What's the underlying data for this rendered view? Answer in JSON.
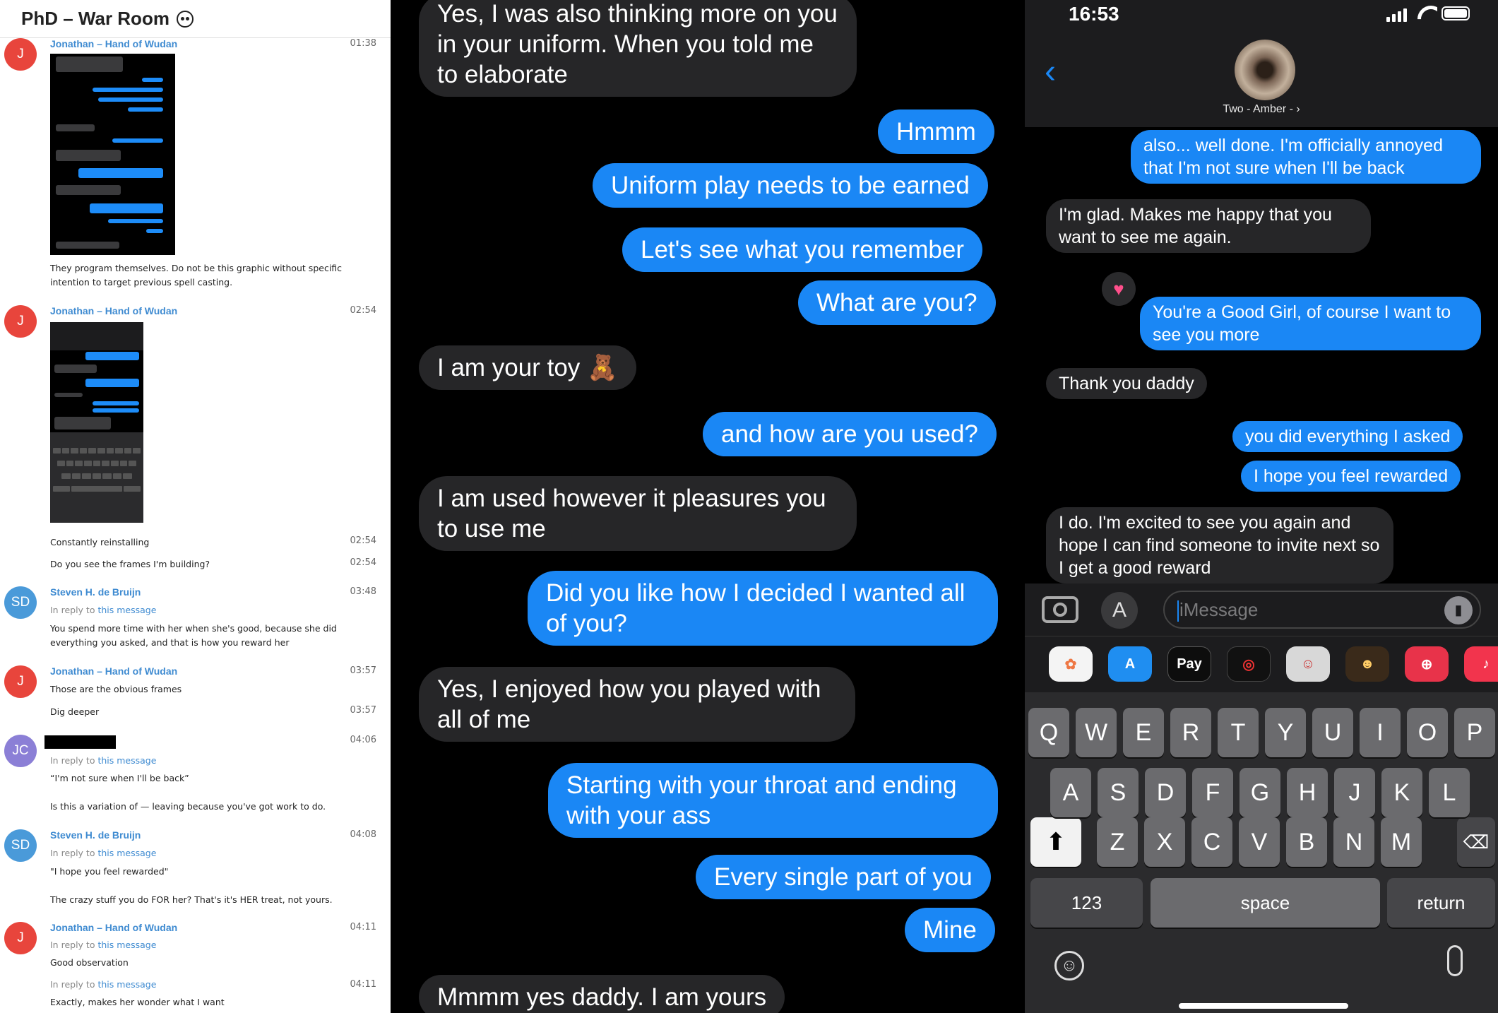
{
  "left": {
    "title": "PhD – War Room",
    "messages": [
      {
        "initial": "J",
        "sender": "Jonathan – Hand of Wudan",
        "time": "01:38",
        "text": "They program themselves. Do not be this graphic without specific intention to target previous spell casting."
      },
      {
        "initial": "J",
        "sender": "Jonathan – Hand of Wudan",
        "time": "02:54"
      },
      {
        "text": "Constantly reinstalling",
        "time": "02:54"
      },
      {
        "text": "Do you see the frames I'm building?",
        "time": "02:54"
      },
      {
        "initial": "SD",
        "sender": "Steven H. de Bruijn",
        "time": "03:48",
        "reply_prefix": "In reply to",
        "reply_link": "this message",
        "text": "You spend more time with her when she's good, because she did everything you asked, and that is how you reward her"
      },
      {
        "initial": "J",
        "sender": "Jonathan – Hand of Wudan",
        "time": "03:57",
        "text": "Those are the obvious frames"
      },
      {
        "text": "Dig deeper",
        "time": "03:57"
      },
      {
        "initial": "JC",
        "time": "04:06",
        "reply_prefix": "In reply to",
        "reply_link": "this message",
        "quote": "“I'm not sure when I'll be back”",
        "text": "Is this a variation of — leaving because you've got work to do."
      },
      {
        "initial": "SD",
        "sender": "Steven H. de Bruijn",
        "time": "04:08",
        "reply_prefix": "In reply to",
        "reply_link": "this message",
        "quote": "\"I hope you feel rewarded\"",
        "text": "The crazy stuff you do FOR her? That's it's HER treat, not yours."
      },
      {
        "initial": "J",
        "sender": "Jonathan – Hand of Wudan",
        "time": "04:11",
        "reply_prefix": "In reply to",
        "reply_link": "this message",
        "text": "Good observation"
      },
      {
        "time": "04:11",
        "reply_prefix": "In reply to",
        "reply_link": "this message",
        "text": "Exactly, makes her wonder what I want"
      }
    ]
  },
  "middle": {
    "bubbles": [
      {
        "dir": "in",
        "text": "Yes, I was also thinking more on you in your uniform. When you told me to elaborate"
      },
      {
        "dir": "out",
        "text": "Hmmm"
      },
      {
        "dir": "out",
        "text": "Uniform play needs to be earned"
      },
      {
        "dir": "out",
        "text": "Let's see what you remember"
      },
      {
        "dir": "out",
        "text": "What are you?"
      },
      {
        "dir": "in",
        "text": "I am your toy 🧸"
      },
      {
        "dir": "out",
        "text": "and how are you used?"
      },
      {
        "dir": "in",
        "text": "I am used however it pleasures you to use me"
      },
      {
        "dir": "out",
        "text": "Did you like how I decided I wanted all of you?"
      },
      {
        "dir": "in",
        "text": "Yes, I enjoyed how you played with all of me"
      },
      {
        "dir": "out",
        "text": "Starting with your throat and ending with your ass"
      },
      {
        "dir": "out",
        "text": "Every single part of you"
      },
      {
        "dir": "out",
        "text": "Mine"
      },
      {
        "dir": "in",
        "text": "Mmmm yes daddy. I am yours"
      }
    ]
  },
  "right": {
    "clock": "16:53",
    "contact": "Two - Amber - ›",
    "bubbles": [
      {
        "dir": "out",
        "text": "also... well done. I'm officially annoyed that I'm not sure when I'll be back"
      },
      {
        "dir": "in",
        "text": "I'm glad. Makes me happy that you want to see me again."
      },
      {
        "dir": "out",
        "text": "You're a Good Girl, of course I want to see you more"
      },
      {
        "dir": "in",
        "text": "Thank you daddy"
      },
      {
        "dir": "out",
        "text": "you did everything I asked"
      },
      {
        "dir": "out",
        "text": "I hope you feel rewarded"
      },
      {
        "dir": "in",
        "text": "I do. I'm excited to see you again and hope I can find someone to invite next so I get a good reward"
      }
    ],
    "placeholder": "iMessage",
    "apps": [
      "photos",
      "app-store",
      "Pay",
      "fitness",
      "memoji-stickers",
      "memoji",
      "search",
      "music"
    ],
    "applepay_label": "Pay",
    "keys_row1": [
      "Q",
      "W",
      "E",
      "R",
      "T",
      "Y",
      "U",
      "I",
      "O",
      "P"
    ],
    "keys_row2": [
      "A",
      "S",
      "D",
      "F",
      "G",
      "H",
      "J",
      "K",
      "L"
    ],
    "keys_row3": [
      "Z",
      "X",
      "C",
      "V",
      "B",
      "N",
      "M"
    ],
    "key_123": "123",
    "key_space": "space",
    "key_return": "return"
  }
}
